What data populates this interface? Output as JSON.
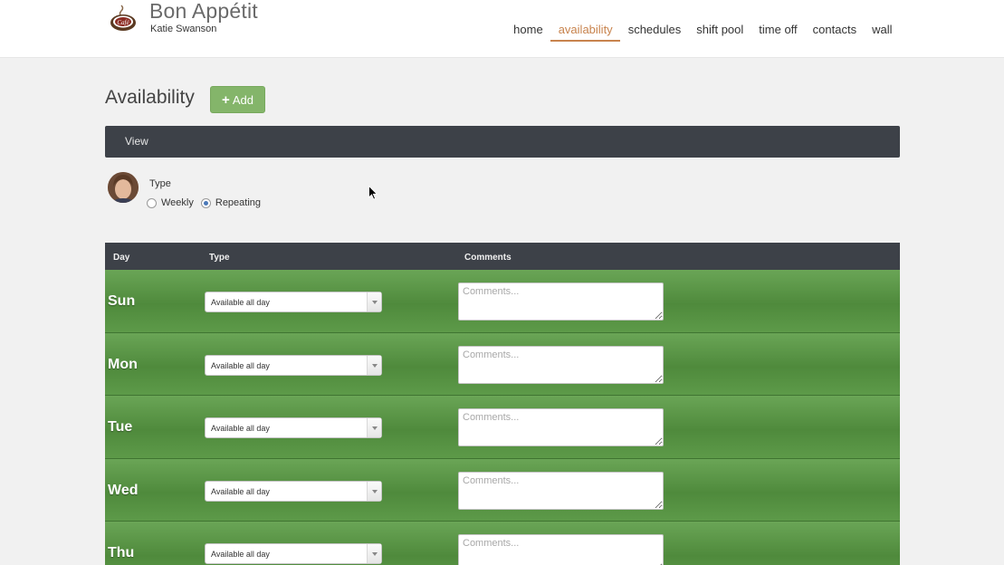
{
  "header": {
    "brand_name": "Bon Appétit",
    "user_name": "Katie Swanson",
    "nav": [
      {
        "label": "home",
        "active": false
      },
      {
        "label": "availability",
        "active": true
      },
      {
        "label": "schedules",
        "active": false
      },
      {
        "label": "shift pool",
        "active": false
      },
      {
        "label": "time off",
        "active": false
      },
      {
        "label": "contacts",
        "active": false
      },
      {
        "label": "wall",
        "active": false
      }
    ]
  },
  "page": {
    "title": "Availability",
    "add_label": "Add",
    "view_label": "View"
  },
  "type_section": {
    "label": "Type",
    "options": [
      {
        "label": "Weekly",
        "checked": false
      },
      {
        "label": "Repeating",
        "checked": true
      }
    ]
  },
  "table": {
    "headers": {
      "day": "Day",
      "type": "Type",
      "comments": "Comments"
    },
    "rows": [
      {
        "day": "Sun",
        "type": "Available all day",
        "comments_placeholder": "Comments..."
      },
      {
        "day": "Mon",
        "type": "Available all day",
        "comments_placeholder": "Comments..."
      },
      {
        "day": "Tue",
        "type": "Available all day",
        "comments_placeholder": "Comments..."
      },
      {
        "day": "Wed",
        "type": "Available all day",
        "comments_placeholder": "Comments..."
      },
      {
        "day": "Thu",
        "type": "Available all day",
        "comments_placeholder": "Comments..."
      }
    ]
  },
  "colors": {
    "accent": "#c8834d",
    "add_button": "#84b56a",
    "dark_bar": "#3d4148",
    "row_green": "#5d9a49"
  },
  "icons": {
    "logo": "cafe-cup-logo-icon",
    "add": "plus-icon",
    "select_arrow": "chevron-down-icon",
    "cursor": "mouse-pointer-icon"
  }
}
